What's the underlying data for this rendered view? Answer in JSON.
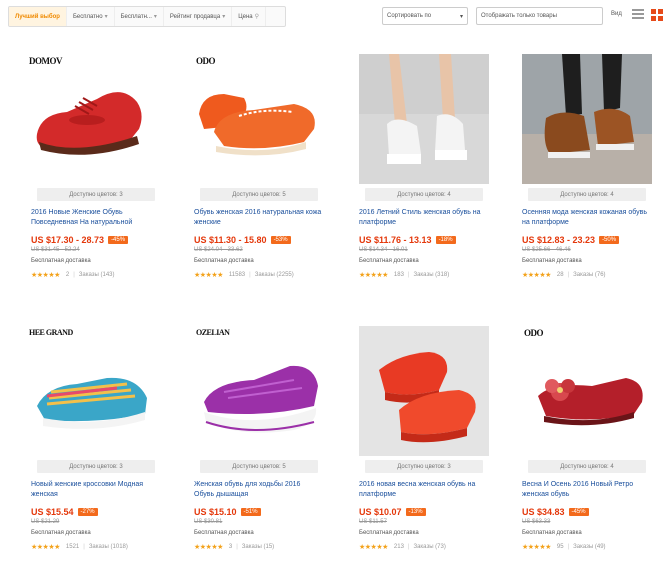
{
  "toolbar": {
    "filters": [
      {
        "label": "Лучший выбор",
        "active": true
      },
      {
        "label": "Бесплатно",
        "active": false
      },
      {
        "label": "Бесплатн...",
        "active": false
      },
      {
        "label": "Рейтинг продавца",
        "active": false
      },
      {
        "label": "Цена",
        "active": false
      }
    ],
    "sort_label": "Сортировать по",
    "ship_label": "Отображать только товары",
    "view_label": "Вид"
  },
  "products": [
    {
      "brand": "DOMOV",
      "badge": "Доступно цветов: 3",
      "title": "2016 Новые Женские Обувь Повседневная На натуральной",
      "price": "US $17.30 - 28.73",
      "discount": "-45%",
      "old_price": "US $31.45 - 52.24",
      "shipping": "Бесплатная доставка",
      "rating": "★★★★★",
      "orders": "2",
      "feedback": "Заказы (143)",
      "image": "red-lace-up-shoe",
      "accent": "#d32a2a"
    },
    {
      "brand": "ODO",
      "badge": "Доступно цветов: 5",
      "title": "Обувь женская 2016 натуральная кожа женские",
      "price": "US $11.30 - 15.80",
      "discount": "-53%",
      "old_price": "US $24.04 - 33.62",
      "shipping": "Бесплатная доставка",
      "rating": "★★★★★",
      "orders": "11583",
      "feedback": "Заказы (2255)",
      "image": "orange-moccasin",
      "accent": "#ef5a1e"
    },
    {
      "brand": "",
      "badge": "Доступно цветов: 4",
      "title": "2016 Летний Стиль женская обувь на платформе",
      "price": "US $11.76 - 13.13",
      "discount": "-18%",
      "old_price": "US $14.34 - 16.01",
      "shipping": "Бесплатная доставка",
      "rating": "★★★★★",
      "orders": "183",
      "feedback": "Заказы (318)",
      "image": "white-platform-sandal",
      "accent": "#e8e8e8"
    },
    {
      "brand": "",
      "badge": "Доступно цветов: 4",
      "title": "Осенняя мода женская кожаная обувь на платформе",
      "price": "US $12.83 - 23.23",
      "discount": "-50%",
      "old_price": "US $25.66 - 46.46",
      "shipping": "Бесплатная доставка",
      "rating": "★★★★★",
      "orders": "28",
      "feedback": "Заказы (76)",
      "image": "brown-fur-slipon",
      "accent": "#8a4a1e"
    },
    {
      "brand": "HEE GRAND",
      "badge": "Доступно цветов: 3",
      "title": "Новый женские кроссовки Модная женская",
      "price": "US $15.54",
      "discount": "-27%",
      "old_price": "US $21.29",
      "shipping": "Бесплатная доставка",
      "rating": "★★★★★",
      "orders": "1521",
      "feedback": "Заказы (1018)",
      "image": "striped-sneaker",
      "accent": "#3aa6c8"
    },
    {
      "brand": "OZELIAN",
      "badge": "Доступно цветов: 5",
      "title": "Женская обувь для ходьбы 2016 Обувь дышащая",
      "price": "US $15.10",
      "discount": "-51%",
      "old_price": "US $30.81",
      "shipping": "Бесплатная доставка",
      "rating": "★★★★★",
      "orders": "3",
      "feedback": "Заказы (15)",
      "image": "purple-rocker-sneaker",
      "accent": "#9b30a8"
    },
    {
      "brand": "",
      "badge": "Доступно цветов: 3",
      "title": "2016 новая весна женская обувь на платформе",
      "price": "US $10.07",
      "discount": "-13%",
      "old_price": "US $11.57",
      "shipping": "Бесплатная доставка",
      "rating": "★★★★★",
      "orders": "213",
      "feedback": "Заказы (73)",
      "image": "red-slipon",
      "accent": "#e83a24"
    },
    {
      "brand": "ODO",
      "badge": "Доступно цветов: 4",
      "title": "Весна И Осень 2016 Новый Ретро женская обувь",
      "price": "US $34.83",
      "discount": "-45%",
      "old_price": "US $63.33",
      "shipping": "Бесплатная доставка",
      "rating": "★★★★★",
      "orders": "95",
      "feedback": "Заказы (49)",
      "image": "red-flower-flat",
      "accent": "#b41f2a"
    }
  ]
}
